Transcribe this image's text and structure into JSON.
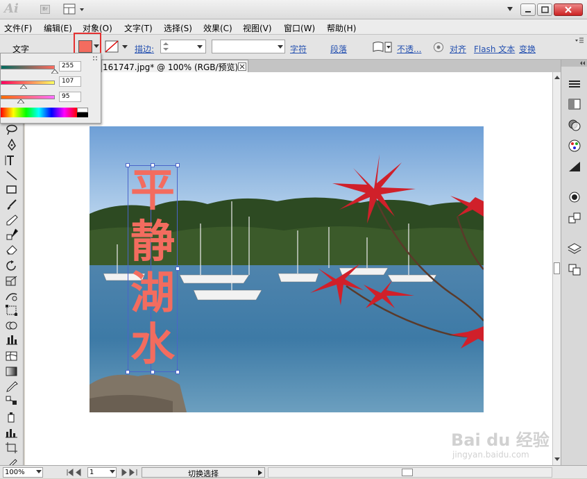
{
  "app": {
    "logo": "Ai",
    "bridge_badge": "Br"
  },
  "menu": [
    "文件(F)",
    "编辑(E)",
    "对象(O)",
    "文字(T)",
    "选择(S)",
    "效果(C)",
    "视图(V)",
    "窗口(W)",
    "帮助(H)"
  ],
  "control_bar": {
    "mode_label": "文字",
    "fill_color": "#f36c5f",
    "stroke_label": "描边:",
    "links": [
      "字符",
      "段落",
      "不透...",
      "对齐",
      "Flash 文本",
      "变换"
    ]
  },
  "document": {
    "tab_title": "161747.jpg* @ 100% (RGB/预览)"
  },
  "color_panel": {
    "r": "255",
    "g": "107",
    "b": "95",
    "r_fraction": 1.0,
    "g_fraction": 0.42,
    "b_fraction": 0.37
  },
  "artwork": {
    "text_chars": [
      "平",
      "静",
      "湖",
      "水"
    ],
    "text_color": "#f36c5f"
  },
  "status": {
    "zoom": "100%",
    "page": "1",
    "mode_label": "切换选择"
  },
  "watermark": {
    "brand": "Bai du 经验",
    "url": "jingyan.baidu.com"
  }
}
